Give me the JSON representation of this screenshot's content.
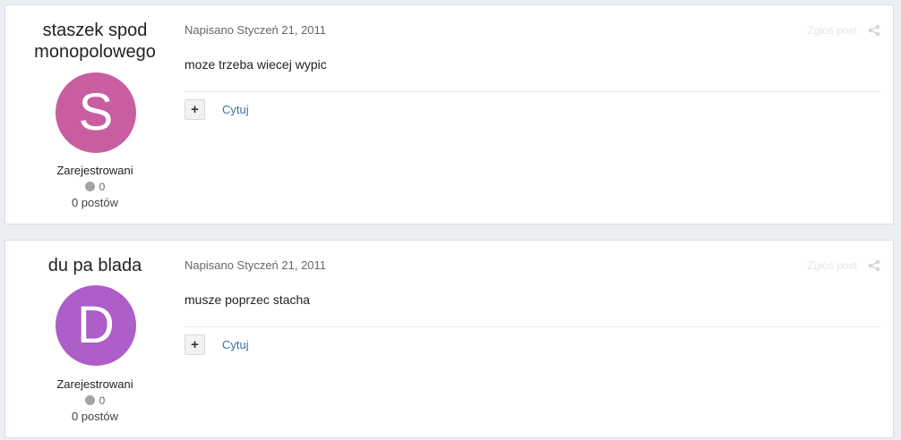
{
  "posts": [
    {
      "author": "staszek spod\nmonopolowego",
      "avatar_letter": "S",
      "avatar_color": "#c85ea0",
      "group": "Zarejestrowani",
      "reputation": "0",
      "post_count": "0 postów",
      "date": "Napisano Styczeń 21, 2011",
      "report": "Zgłoś post",
      "content": "moze trzeba wiecej wypic",
      "rep_button": "+",
      "quote": "Cytuj"
    },
    {
      "author": "du pa blada",
      "avatar_letter": "D",
      "avatar_color": "#ad5ec8",
      "group": "Zarejestrowani",
      "reputation": "0",
      "post_count": "0 postów",
      "date": "Napisano Styczeń 21, 2011",
      "report": "Zgłoś post",
      "content": "musze poprzec stacha",
      "rep_button": "+",
      "quote": "Cytuj"
    }
  ],
  "icons": {
    "share": "share-icon",
    "reputation": "reputation-dot-icon"
  }
}
